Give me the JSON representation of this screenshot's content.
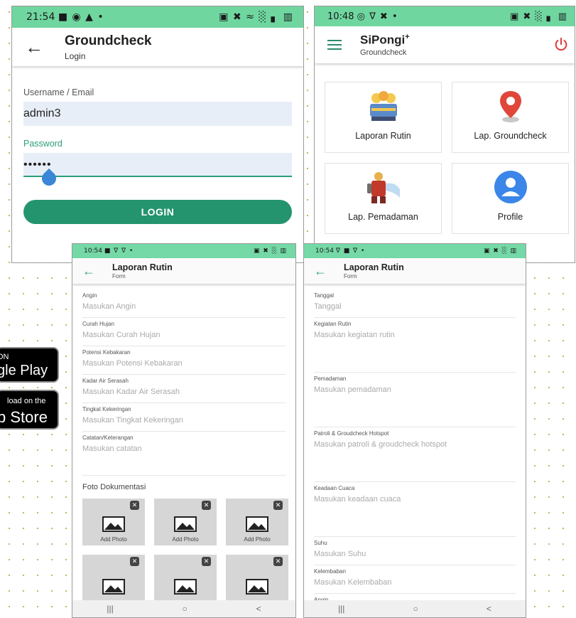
{
  "login": {
    "time": "21:54",
    "left_status_icons": "■ ◉ ▲ •",
    "right_status_icons": "▣ ✖ ≈ ░ ▖ ▥",
    "title": "Groundcheck",
    "subtitle": "Login",
    "username_label": "Username / Email",
    "username_value": "admin3",
    "password_label": "Password",
    "password_value": "••••••",
    "login_button": "LOGIN"
  },
  "menu": {
    "time": "10:48",
    "left_status_icons": "◎ ∇ ✖ •",
    "right_status_icons": "▣ ✖ ░ ▖ ▥",
    "title": "SiPongi",
    "title_sup": "+",
    "subtitle": "Groundcheck",
    "tiles": [
      {
        "label": "Laporan Rutin",
        "icon": "workers-icon"
      },
      {
        "label": "Lap. Groundcheck",
        "icon": "location-pin-icon"
      },
      {
        "label": "Lap. Pemadaman",
        "icon": "firefighter-icon"
      },
      {
        "label": "Profile",
        "icon": "user-profile-icon"
      }
    ]
  },
  "badges": {
    "google_small": "ON",
    "google_big": "gle Play",
    "apple_small": "load on the",
    "apple_big": "p Store"
  },
  "form1": {
    "time": "10:54",
    "left_status_icons": "■ ∇ ∇ •",
    "right_status_icons": "▣ ✖ ░ ▥",
    "title": "Laporan Rutin",
    "subtitle": "Form",
    "fields": [
      {
        "label": "Angin",
        "placeholder": "Masukan Angin"
      },
      {
        "label": "Curah Hujan",
        "placeholder": "Masukan Curah Hujan"
      },
      {
        "label": "Potensi Kebakaran",
        "placeholder": "Masukan Potensi Kebakaran"
      },
      {
        "label": "Kadar Air Serasah",
        "placeholder": "Masukan Kadar Air Serasah"
      },
      {
        "label": "Tingkat Kekeringan",
        "placeholder": "Masukan Tingkat Kekeringan"
      },
      {
        "label": "Catatan/Keterangan",
        "placeholder": "Masukan catatan"
      }
    ],
    "foto_title": "Foto Dokumentasi",
    "add_photo": "Add Photo",
    "nav_recent": "|||",
    "nav_home": "○",
    "nav_back": "<"
  },
  "form2": {
    "time": "10:54",
    "left_status_icons": "∇ ■ ∇ •",
    "right_status_icons": "▣ ✖ ░ ▥",
    "title": "Laporan Rutin",
    "subtitle": "Form",
    "fields": [
      {
        "label": "Tanggal",
        "placeholder": "Tanggal"
      },
      {
        "label": "Kegiatan Rutin",
        "placeholder": "Masukan kegiatan rutin"
      },
      {
        "label": "Pemadaman",
        "placeholder": "Masukan pemadaman"
      },
      {
        "label": "Patroli & Groudcheck Hotspot",
        "placeholder": "Masukan patroli & groudcheck hotspot"
      },
      {
        "label": "Keadaan Cuaca",
        "placeholder": "Masukan keadaan cuaca"
      },
      {
        "label": "Suhu",
        "placeholder": "Masukan Suhu"
      },
      {
        "label": "Kelembaban",
        "placeholder": "Masukan Kelembaban"
      },
      {
        "label": "Angin",
        "placeholder": ""
      }
    ],
    "nav_recent": "|||",
    "nav_home": "○",
    "nav_back": "<"
  },
  "colors": {
    "statusbar": "#6fd6a0",
    "primary": "#24946f",
    "power": "#e03a3a",
    "pin": "#e0473a",
    "profile": "#3b86e8"
  }
}
